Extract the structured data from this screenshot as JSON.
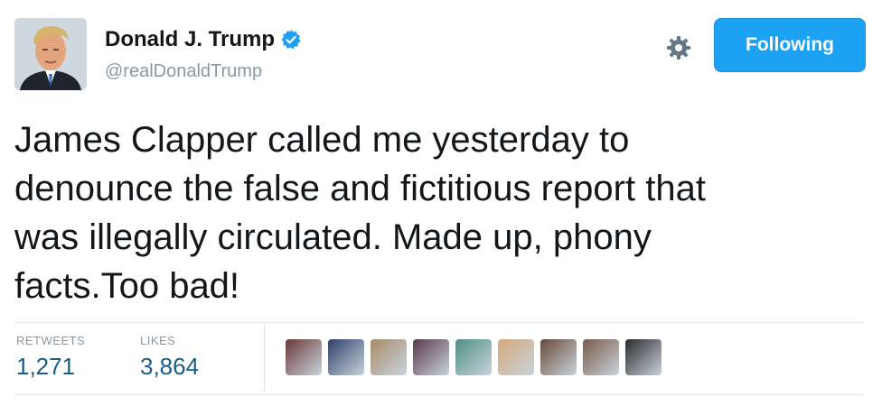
{
  "header": {
    "display_name": "Donald J. Trump",
    "handle": "@realDonaldTrump",
    "follow_button_label": "Following",
    "icons": {
      "verified": "verified-badge-icon",
      "settings": "gear-icon"
    }
  },
  "tweet": {
    "text": "James Clapper called me yesterday to\ndenounce the false and fictitious report that\nwas illegally circulated. Made up, phony\nfacts.Too bad!"
  },
  "stats": {
    "retweets_label": "RETWEETS",
    "retweets_count": "1,271",
    "likes_label": "LIKES",
    "likes_count": "3,864"
  },
  "likers": [
    {
      "color": "#6b3a3a"
    },
    {
      "color": "#2f3f6a"
    },
    {
      "color": "#a88c6a"
    },
    {
      "color": "#5a3a4a"
    },
    {
      "color": "#4f8f86"
    },
    {
      "color": "#d7a87a"
    },
    {
      "color": "#6a4a3a"
    },
    {
      "color": "#7a5a4a"
    },
    {
      "color": "#2a2a2a"
    }
  ],
  "colors": {
    "accent": "#1da1f2",
    "stat_value": "#1b5d86",
    "muted": "#8899a6"
  }
}
